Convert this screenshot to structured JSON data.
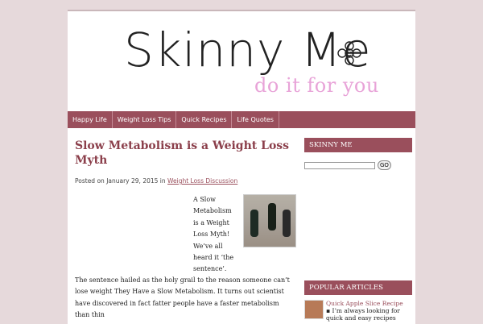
{
  "site": {
    "title": "Skinny Me",
    "tagline": "do it for you"
  },
  "nav": {
    "items": [
      "Happy Life",
      "Weight Loss Tips",
      "Quick Recipes",
      "Life Quotes"
    ]
  },
  "post": {
    "title": "Slow Metabolism is a Weight Loss Myth",
    "meta_prefix": "Posted on",
    "date": "January 29, 2015",
    "meta_in": "in",
    "category": "Weight Loss Discussion",
    "narrow_text": "A Slow Metabolism is a Weight Loss Myth! We’ve all heard it ‘the sentence’.",
    "full_text": "The sentence hailed as the holy grail to the reason someone can’t lose weight They Have a Slow Metabolism. It turns out scientist have discovered in fact fatter people have a faster metabolism than thin"
  },
  "sidebar": {
    "widget_title": "SKINNY ME",
    "search_placeholder": "",
    "search_button": "GO",
    "popular_title": "POPULAR ARTICLES",
    "popular_items": [
      {
        "title": "Quick Apple Slice Recipe",
        "excerpt": "I’m always looking for quick and easy recipes"
      }
    ]
  },
  "colors": {
    "accent": "#9a4f5c",
    "background": "#e6d9db",
    "tagline": "#e8a3d8"
  },
  "icons": {
    "logo_flower": "flower-icon",
    "post_image": "runner-photo"
  }
}
